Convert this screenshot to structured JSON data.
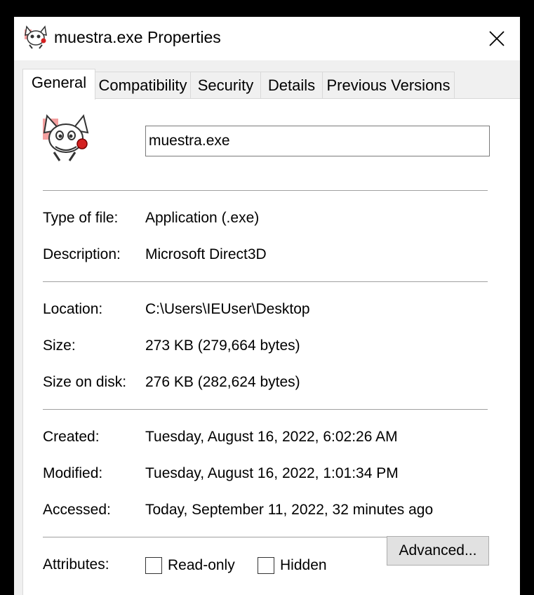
{
  "window": {
    "title": "muestra.exe Properties",
    "close_icon": "close-icon",
    "app_icon": "cat-program-icon"
  },
  "tabs": [
    {
      "label": "General",
      "active": true
    },
    {
      "label": "Compatibility",
      "active": false
    },
    {
      "label": "Security",
      "active": false
    },
    {
      "label": "Details",
      "active": false
    },
    {
      "label": "Previous Versions",
      "active": false
    }
  ],
  "general": {
    "file_icon": "cat-program-icon",
    "file_name": "muestra.exe",
    "type_of_file": {
      "label": "Type of file:",
      "value": "Application (.exe)"
    },
    "description": {
      "label": "Description:",
      "value": "Microsoft Direct3D"
    },
    "location": {
      "label": "Location:",
      "value": "C:\\Users\\IEUser\\Desktop"
    },
    "size": {
      "label": "Size:",
      "value": "273 KB (279,664 bytes)"
    },
    "size_on_disk": {
      "label": "Size on disk:",
      "value": "276 KB (282,624 bytes)"
    },
    "created": {
      "label": "Created:",
      "value": "Tuesday, August 16, 2022, 6:02:26 AM"
    },
    "modified": {
      "label": "Modified:",
      "value": "Tuesday, August 16, 2022, 1:01:34 PM"
    },
    "accessed": {
      "label": "Accessed:",
      "value": "Today, September 11, 2022, 32 minutes ago"
    },
    "attributes": {
      "label": "Attributes:",
      "read_only": {
        "label": "Read-only",
        "checked": false
      },
      "hidden": {
        "label": "Hidden",
        "checked": false
      },
      "advanced_label": "Advanced..."
    }
  },
  "colors": {
    "background": "#000000",
    "window_bg": "#f0f0f0",
    "panel_bg": "#ffffff",
    "separator": "#a0a0a0",
    "button_bg": "#e1e1e1"
  }
}
